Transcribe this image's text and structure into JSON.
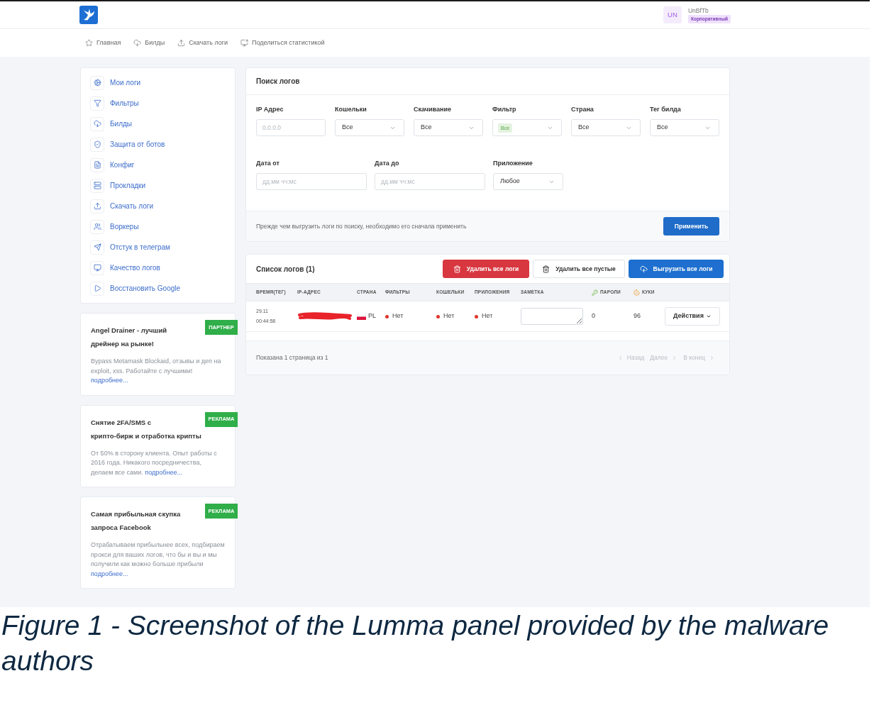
{
  "header": {
    "avatar_initials": "UN",
    "user_name": "UnBfTb",
    "plan_badge": "Корпоративный"
  },
  "nav": [
    {
      "label": "Главная"
    },
    {
      "label": "Билды"
    },
    {
      "label": "Скачать логи"
    },
    {
      "label": "Поделиться статистикой"
    }
  ],
  "sidebar": {
    "items": [
      {
        "label": "Мои логи"
      },
      {
        "label": "Фильтры"
      },
      {
        "label": "Билды"
      },
      {
        "label": "Защита от ботов"
      },
      {
        "label": "Конфиг"
      },
      {
        "label": "Прокладки"
      },
      {
        "label": "Скачать логи"
      },
      {
        "label": "Воркеры"
      },
      {
        "label": "Отстук в телеграм"
      },
      {
        "label": "Качество логов"
      },
      {
        "label": "Восстановить Google"
      }
    ]
  },
  "ads": [
    {
      "title": "Angel Drainer - лучший дрейнер на рынке!",
      "badge": "ПАРТНЕР",
      "text": "Bypass Metamask Blockaid, отзывы и деп на exploit, xss. Работайте с лучшими!",
      "link": "подробнее..."
    },
    {
      "title": "Снятие 2FA/SMS с крипто-бирж и отработка крипты",
      "badge": "РЕКЛАМА",
      "text": "От 50% в сторону клиента. Опыт работы с 2016 года. Никакого посредничества, делаем все сами.",
      "link": "подробнее..."
    },
    {
      "title": "Самая прибыльная скупка запроса Facebook",
      "badge": "РЕКЛАМА",
      "text": "Отрабатываем прибыльнее всех, подбираем прокси для ваших логов, что бы и вы и мы получили как можно больше прибыли",
      "link": "подробнее..."
    }
  ],
  "search": {
    "title": "Поиск логов",
    "fields": [
      {
        "label": "IP Адрес",
        "kind": "input",
        "placeholder": "0.0.0.0"
      },
      {
        "label": "Кошельки",
        "kind": "select",
        "value": "Все"
      },
      {
        "label": "Скачивание",
        "kind": "select",
        "value": "Все"
      },
      {
        "label": "Фильтр",
        "kind": "tag",
        "value": "Все"
      },
      {
        "label": "Страна",
        "kind": "select",
        "value": "Все"
      },
      {
        "label": "Тег билда",
        "kind": "select",
        "value": "Все"
      }
    ],
    "more_fields": [
      {
        "label": "Дата от",
        "kind": "input",
        "placeholder": "дд.мм чч:мс"
      },
      {
        "label": "Дата до",
        "kind": "input",
        "placeholder": "дд.мм чч:мс"
      },
      {
        "label": "Приложение",
        "kind": "select",
        "value": "Любое"
      }
    ],
    "hint": "Прежде чем выгрузить логи по поиску, необходимо его сначала применить",
    "apply_button": "Применить"
  },
  "logs": {
    "title": "Список логов (1)",
    "buttons": [
      {
        "label": "Удалить все логи",
        "kind": "danger"
      },
      {
        "label": "Удалить все пустые",
        "kind": "outline"
      },
      {
        "label": "Выгрузить все логи",
        "kind": "primary"
      }
    ],
    "table": {
      "columns": [
        "ВРЕМЯ(ТЕГ)",
        "IP-АДРЕС",
        "СТРАНА",
        "ФИЛЬТРЫ",
        "КОШЕЛЬКИ",
        "ПРИЛОЖЕНИЯ",
        "ЗАМЕТКА",
        "ПАРОЛИ",
        "КУКИ"
      ],
      "rows": [
        {
          "date": "29.11",
          "time": "00:44:58",
          "ip_redacted": true,
          "country": "PL",
          "filters": "Нет",
          "wallets": "Нет",
          "apps": "Нет",
          "passwords": "0",
          "cookies": "96",
          "action": "Действия"
        }
      ]
    },
    "footer": {
      "summary": "Показана 1 страница из 1",
      "pages": [
        {
          "kind": "prev",
          "label": "Назад",
          "disabled": true
        },
        {
          "kind": "next",
          "label": "Далее",
          "disabled": true
        },
        {
          "kind": "last",
          "label": "В конец",
          "disabled": true
        }
      ]
    }
  },
  "caption": "Figure 1 - Screenshot of the Lumma panel provided by the malware authors"
}
